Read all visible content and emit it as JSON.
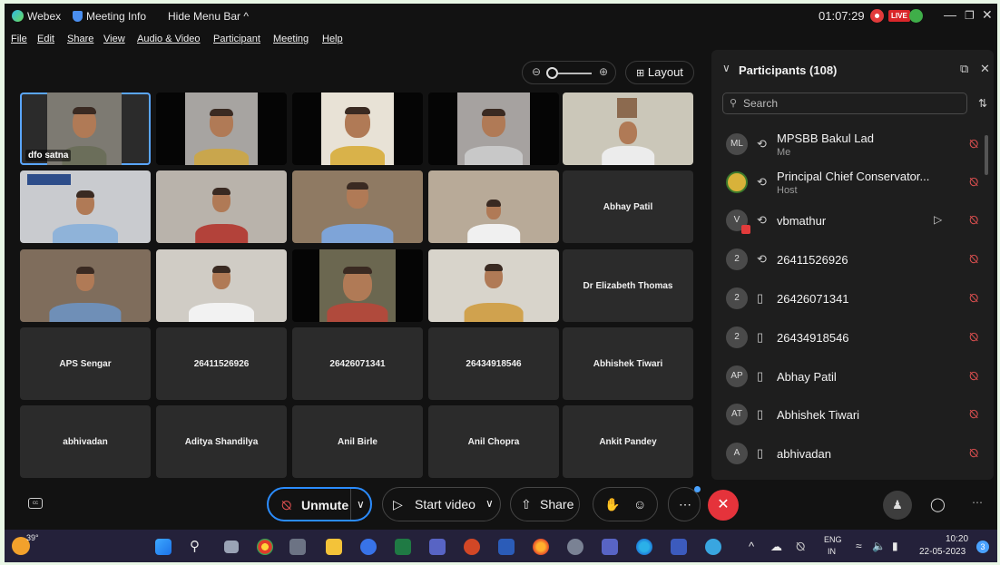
{
  "titlebar": {
    "app_name": "Webex",
    "meeting_info": "Meeting Info",
    "hide_menu": "Hide Menu Bar",
    "timer": "01:07:29",
    "live": "LIVE"
  },
  "menu": [
    "File",
    "Edit",
    "Share",
    "View",
    "Audio & Video",
    "Participant",
    "Meeting",
    "Help"
  ],
  "layout_label": "Layout",
  "tiles": [
    {
      "name": "dfo satna",
      "kind": "video"
    },
    {
      "name": "",
      "kind": "video"
    },
    {
      "name": "",
      "kind": "video"
    },
    {
      "name": "",
      "kind": "video"
    },
    {
      "name": "",
      "kind": "video"
    },
    {
      "name": "",
      "kind": "video"
    },
    {
      "name": "",
      "kind": "video"
    },
    {
      "name": "",
      "kind": "video"
    },
    {
      "name": "",
      "kind": "video"
    },
    {
      "name": "Abhay Patil",
      "kind": "name"
    },
    {
      "name": "",
      "kind": "video"
    },
    {
      "name": "",
      "kind": "video"
    },
    {
      "name": "",
      "kind": "video"
    },
    {
      "name": "",
      "kind": "video"
    },
    {
      "name": "Dr Elizabeth Thomas",
      "kind": "name"
    },
    {
      "name": "APS Sengar",
      "kind": "name"
    },
    {
      "name": "26411526926",
      "kind": "name"
    },
    {
      "name": "26426071341",
      "kind": "name"
    },
    {
      "name": "26434918546",
      "kind": "name"
    },
    {
      "name": "Abhishek Tiwari",
      "kind": "name"
    },
    {
      "name": "abhivadan",
      "kind": "name"
    },
    {
      "name": "Aditya Shandilya",
      "kind": "name"
    },
    {
      "name": "Anil Birle",
      "kind": "name"
    },
    {
      "name": "Anil Chopra",
      "kind": "name"
    },
    {
      "name": "Ankit Pandey",
      "kind": "name"
    }
  ],
  "participants_panel": {
    "title": "Participants (108)",
    "search_placeholder": "Search",
    "list": [
      {
        "initials": "ML",
        "name": "MPSBB Bakul Lad",
        "role": "Me",
        "type": "computer"
      },
      {
        "initials": "",
        "name": "Principal Chief Conservator...",
        "role": "Host",
        "type": "computer"
      },
      {
        "initials": "V",
        "name": "vbmathur",
        "role": "",
        "type": "computer"
      },
      {
        "initials": "2",
        "name": "26411526926",
        "role": "",
        "type": "computer"
      },
      {
        "initials": "2",
        "name": "26426071341",
        "role": "",
        "type": "phone"
      },
      {
        "initials": "2",
        "name": "26434918546",
        "role": "",
        "type": "phone"
      },
      {
        "initials": "AP",
        "name": "Abhay Patil",
        "role": "",
        "type": "phone"
      },
      {
        "initials": "AT",
        "name": "Abhishek Tiwari",
        "role": "",
        "type": "phone"
      },
      {
        "initials": "A",
        "name": "abhivadan",
        "role": "",
        "type": "phone"
      }
    ]
  },
  "toolbar": {
    "unmute": "Unmute",
    "start_video": "Start video",
    "share": "Share"
  },
  "taskbar": {
    "temperature": "39°",
    "lang_top": "ENG",
    "lang_bottom": "IN",
    "time": "10:20",
    "date": "22-05-2023",
    "notifications": "3"
  }
}
